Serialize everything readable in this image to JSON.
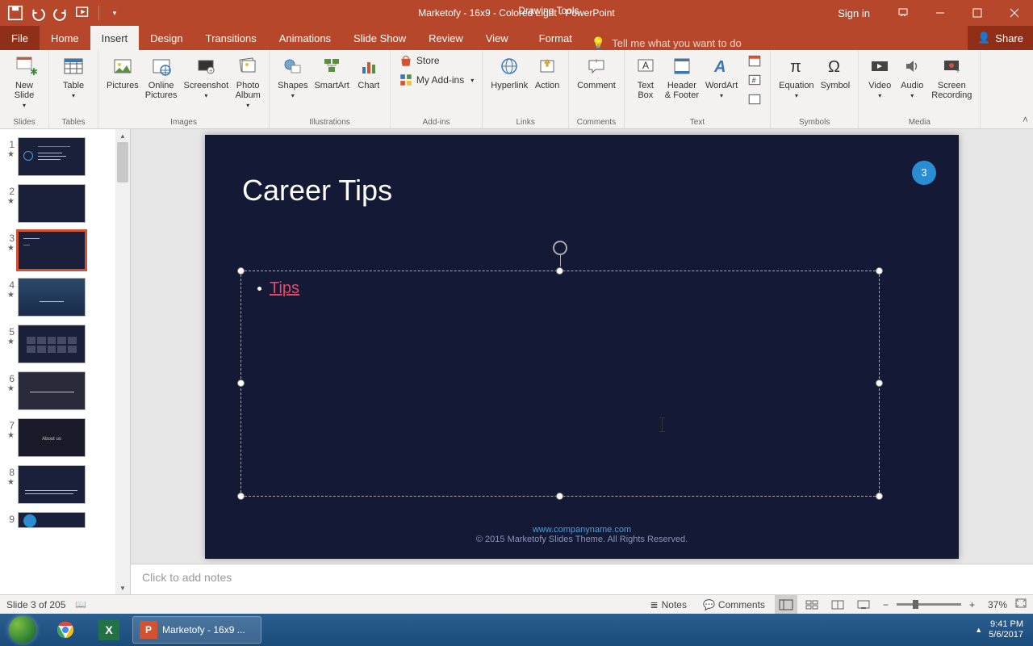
{
  "title": "Marketofy - 16x9 - Colored Light  -  PowerPoint",
  "context_tab_label": "Drawing Tools",
  "signin": "Sign in",
  "tabs": {
    "file": "File",
    "home": "Home",
    "insert": "Insert",
    "design": "Design",
    "transitions": "Transitions",
    "animations": "Animations",
    "slideshow": "Slide Show",
    "review": "Review",
    "view": "View",
    "format": "Format"
  },
  "tellme": "Tell me what you want to do",
  "share": "Share",
  "ribbon": {
    "slides": {
      "label": "Slides",
      "new_slide": "New\nSlide"
    },
    "tables": {
      "label": "Tables",
      "table": "Table"
    },
    "images": {
      "label": "Images",
      "pictures": "Pictures",
      "online_pictures": "Online\nPictures",
      "screenshot": "Screenshot",
      "photo_album": "Photo\nAlbum"
    },
    "illustrations": {
      "label": "Illustrations",
      "shapes": "Shapes",
      "smartart": "SmartArt",
      "chart": "Chart"
    },
    "addins": {
      "label": "Add-ins",
      "store": "Store",
      "my_addins": "My Add-ins"
    },
    "links": {
      "label": "Links",
      "hyperlink": "Hyperlink",
      "action": "Action"
    },
    "comments": {
      "label": "Comments",
      "comment": "Comment"
    },
    "text": {
      "label": "Text",
      "textbox": "Text\nBox",
      "header_footer": "Header\n& Footer",
      "wordart": "WordArt"
    },
    "symbols": {
      "label": "Symbols",
      "equation": "Equation",
      "symbol": "Symbol"
    },
    "media": {
      "label": "Media",
      "video": "Video",
      "audio": "Audio",
      "screen_recording": "Screen\nRecording"
    }
  },
  "slide": {
    "title": "Career Tips",
    "badge": "3",
    "bullet_text": "Tips",
    "footer_url": "www.companyname.com",
    "footer_copy": "© 2015 Marketofy Slides Theme. All Rights Reserved."
  },
  "notes_placeholder": "Click to add notes",
  "status": {
    "slide": "Slide 3 of 205",
    "notes": "Notes",
    "comments": "Comments",
    "zoom": "37%"
  },
  "taskbar": {
    "running": "Marketofy - 16x9 ...",
    "time": "9:41 PM",
    "date": "5/6/2017"
  },
  "thumbs": [
    "1",
    "2",
    "3",
    "4",
    "5",
    "6",
    "7",
    "8",
    "9"
  ]
}
